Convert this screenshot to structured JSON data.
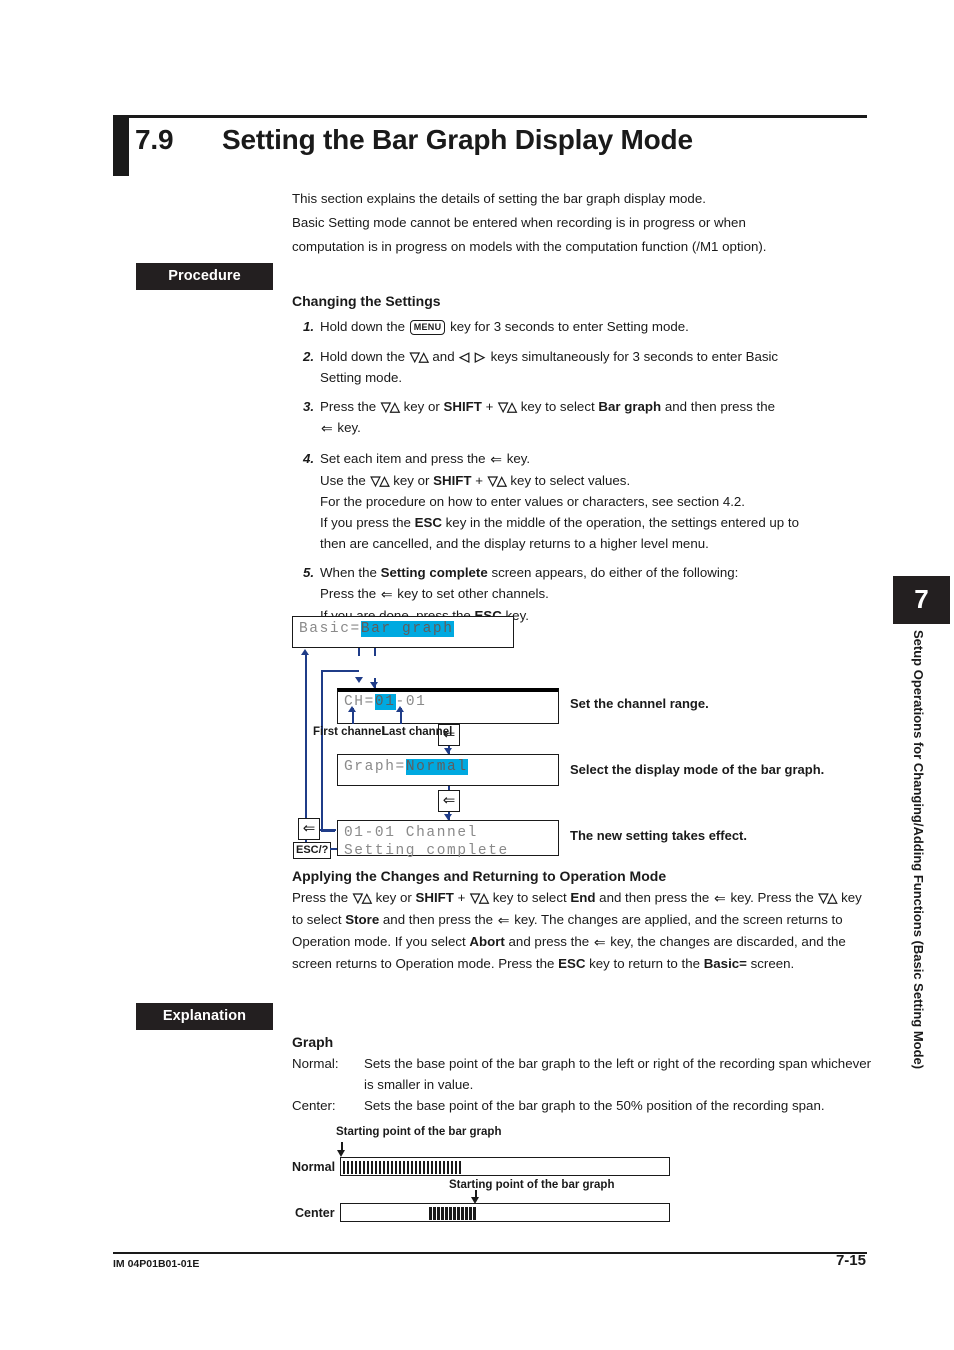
{
  "section": {
    "number": "7.9",
    "title": "Setting the Bar Graph Display Mode"
  },
  "intro": {
    "line1": "This section explains the details of setting the bar graph display mode.",
    "line2": "Basic Setting mode cannot be entered when recording is in progress or when",
    "line3": "computation is in progress on models with the computation function (/M1 option)."
  },
  "tags": {
    "procedure": "Procedure",
    "explanation": "Explanation"
  },
  "procedure": {
    "heading": "Changing the Settings",
    "steps": [
      {
        "num": "1.",
        "parts": [
          "Hold down the ",
          "MENU",
          " key for 3 seconds to enter Setting mode."
        ]
      },
      {
        "num": "2.",
        "line1_a": "Hold down the ",
        "line1_key1": "▽△",
        "line1_b": " and ",
        "line1_key2": "◁ ▷",
        "line1_c": " keys simultaneously for 3 seconds to enter Basic",
        "line2": "Setting mode."
      },
      {
        "num": "3.",
        "line1_a": "Press the ",
        "line1_k1": "▽△",
        "line1_b": " key or ",
        "line1_shift": "SHIFT",
        "line1_c": " + ",
        "line1_k2": "▽△",
        "line1_d": " key to select ",
        "line1_bold": "Bar graph",
        "line1_e": " and then press the",
        "line2_key": "⇐",
        "line2_tail": " key."
      },
      {
        "num": "4.",
        "l1_a": "Set each item and press the ",
        "l1_key": "⇐",
        "l1_b": " key.",
        "l2_a": "Use the ",
        "l2_k1": "▽△",
        "l2_b": " key or ",
        "l2_shift": "SHIFT",
        "l2_c": " + ",
        "l2_k2": "▽△",
        "l2_d": " key to select values.",
        "l3": "For the procedure on how to enter values or characters, see section 4.2.",
        "l4_a": "If you press the ",
        "l4_bold": "ESC",
        "l4_b": " key in the middle of the operation, the settings entered up to",
        "l5": "then are cancelled, and the display returns to a higher level menu."
      },
      {
        "num": "5.",
        "l1_a": "When the ",
        "l1_bold": "Setting complete",
        "l1_b": " screen appears, do either of the following:",
        "l2_a": "Press the ",
        "l2_key": "⇐",
        "l2_b": " key to set other channels.",
        "l3_a": "If you are done, press the ",
        "l3_bold": "ESC",
        "l3_b": " key."
      }
    ]
  },
  "flow": {
    "screens": {
      "basic": {
        "prefix": "Basic=",
        "highlight": "Bar graph"
      },
      "channel": {
        "prefix": "CH=",
        "highlight": "01",
        "suffix": "-01"
      },
      "graph": {
        "prefix": "Graph=",
        "highlight": "Normal"
      },
      "complete": {
        "line1": "01-01 Channel",
        "line2": "Setting complete"
      }
    },
    "labels": {
      "first_channel": "First channel",
      "last_channel": "Last channel",
      "esc_key": "ESC/?",
      "enter_key": "⇐"
    },
    "notes": {
      "channel": "Set the channel range.",
      "graph": "Select the display mode of the bar graph.",
      "complete": "The new setting takes effect."
    }
  },
  "applying": {
    "heading": "Applying the Changes and Returning to Operation Mode",
    "t1": "Press the ",
    "k1": "▽△",
    "t2": " key or ",
    "b1": "SHIFT",
    "t3": " + ",
    "k2": "▽△",
    "t4": " key to select ",
    "b2": "End",
    "t5": " and then press the ",
    "k3": "⇐",
    "t6": " key. Press the ",
    "k4": "▽△",
    "t7": " key to select ",
    "b3": "Store",
    "t8": " and then press the ",
    "k5": "⇐",
    "t9": " key. The changes are applied, and the screen returns to Operation mode. If you select ",
    "b4": "Abort",
    "t10": " and press the ",
    "k6": "⇐",
    "t11": " key, the changes are discarded, and the screen returns to Operation mode. Press the ",
    "b5": "ESC",
    "t12": " key to return to the ",
    "b6": "Basic=",
    "t13": " screen."
  },
  "explanation": {
    "heading": "Graph",
    "definitions": [
      {
        "term": "Normal:",
        "desc": "Sets the base point of the bar graph to the left or right of the recording span whichever is smaller in value."
      },
      {
        "term": "Center:",
        "desc": "Sets the base point of the bar graph to the 50% position of the recording span."
      }
    ]
  },
  "figure": {
    "caption_top": "Starting point of the bar graph",
    "caption_bottom": "Starting point of the bar graph",
    "row_normal": "Normal",
    "row_center": "Center"
  },
  "side_tab": {
    "chapter": "7",
    "text": "Setup Operations for Changing/Adding Functions (Basic Setting Mode)"
  },
  "footer": {
    "doc_id": "IM 04P01B01-01E",
    "page": "7-15"
  },
  "colors": {
    "highlight": "#00a9e0",
    "connector": "#1f3c88",
    "black": "#231f20"
  }
}
